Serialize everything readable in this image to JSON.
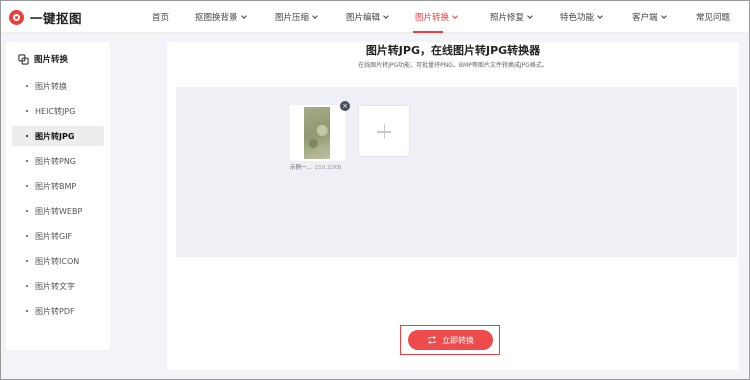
{
  "brand": {
    "name": "一键抠图"
  },
  "nav": [
    {
      "label": "首页",
      "dropdown": false
    },
    {
      "label": "抠图换背景",
      "dropdown": true
    },
    {
      "label": "图片压缩",
      "dropdown": true
    },
    {
      "label": "图片编辑",
      "dropdown": true
    },
    {
      "label": "图片转换",
      "dropdown": true,
      "active": true
    },
    {
      "label": "照片修复",
      "dropdown": true
    },
    {
      "label": "特色功能",
      "dropdown": true
    },
    {
      "label": "客户端",
      "dropdown": true
    },
    {
      "label": "常见问题",
      "dropdown": false
    }
  ],
  "sidebar": {
    "title": "图片转换",
    "items": [
      {
        "label": "图片转换"
      },
      {
        "label": "HEIC转JPG"
      },
      {
        "label": "图片转JPG",
        "active": true
      },
      {
        "label": "图片转PNG"
      },
      {
        "label": "图片转BMP"
      },
      {
        "label": "图片转WEBP"
      },
      {
        "label": "图片转GIF"
      },
      {
        "label": "图片转ICON"
      },
      {
        "label": "图片转文字"
      },
      {
        "label": "图片转PDF"
      }
    ]
  },
  "main": {
    "title": "图片转JPG，在线图片转JPG转换器",
    "subtitle": "在线图片转JPG功能，可批量将PNG、BMP等图片文件转换成JPG格式。",
    "file": {
      "name": "示例一...",
      "size": "210.22KB"
    },
    "convert_label": "立即转换"
  },
  "colors": {
    "accent": "#ee3f3f",
    "button": "#ee4c4c",
    "upload_bg": "#eef0f6"
  }
}
